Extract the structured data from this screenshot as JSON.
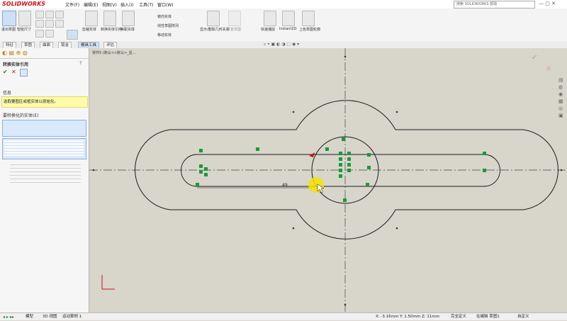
{
  "app": {
    "title": "SOLIDWORKS",
    "search_placeholder": "搜索 SOLIDWORKS 帮助"
  },
  "menu": [
    "文件(F)",
    "编辑(E)",
    "视图(V)",
    "插入(I)",
    "工具(T)",
    "窗口(W)"
  ],
  "ribbon": {
    "exit_sketch": "退出草图",
    "smart_dim": "智能尺寸",
    "trim": "剪裁实体",
    "convert": "转换实体引用",
    "offset": "等距实体",
    "mirror": "镜向实体",
    "linear_array": "线性草图阵列",
    "move": "移动实体",
    "display_relations": "显示/删除几何关系",
    "repair": "修复草图",
    "quick_snap": "快速捕捉",
    "instant2d": "Instant2D",
    "shaded_sketch": "上色草图轮廓"
  },
  "command_tabs": [
    "特征",
    "草图",
    "曲面",
    "钣金",
    "模具工具",
    "评估"
  ],
  "breadcrumb": "零件5 (默认<<默认>_显...",
  "panel": {
    "title": "转换实体引用",
    "info_header": "信息",
    "info_text": "选取要图区或框实体以原始化。",
    "convert_header": "要转换化的实体(E)"
  },
  "status": {
    "coords": "X: -3.16mm Y: 1.50mm Z: 11mm",
    "state": "完全定义",
    "mode": "在编辑 草图1",
    "units": "自定义"
  },
  "bottom_tabs": [
    "模型",
    "3D 视图",
    "运动算例 1"
  ],
  "canvas": {
    "dim_label": "49",
    "colors": {
      "bg": "#d8d5cb",
      "line": "#1a1a1a",
      "handle": "#1a9a3a",
      "highlight": "#f5e400"
    }
  }
}
